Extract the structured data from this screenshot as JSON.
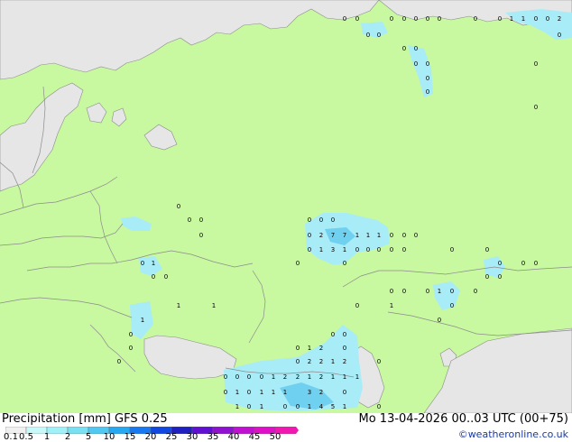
{
  "footer": {
    "title": "Precipitation [mm]  GFS 0.25",
    "datetime": "Mo 13-04-2026 00..03 UTC (00+75)",
    "credit": "©weatheronline.co.uk"
  },
  "legend": {
    "labels": [
      "0.1",
      "0.5",
      "1",
      "2",
      "5",
      "10",
      "15",
      "20",
      "25",
      "30",
      "35",
      "40",
      "45",
      "50"
    ],
    "colors": [
      "#f0f0f0",
      "#c8f8f8",
      "#a0f0f8",
      "#78e0f0",
      "#50c8f0",
      "#28a8f0",
      "#1878f0",
      "#1048e0",
      "#2020c0",
      "#6010d0",
      "#9010d0",
      "#c010d0",
      "#e010c8",
      "#f018b0"
    ]
  },
  "colors": {
    "land": "#c8f8a0",
    "sea": "#e6e6e6",
    "border": "#8c8c8c",
    "precip_light": "#a8ecf8",
    "precip_medium": "#70d0f0"
  },
  "precip_labels": [
    {
      "t": "0",
      "lon": 382,
      "lat": 20
    },
    {
      "t": "0",
      "lon": 396,
      "lat": 20
    },
    {
      "t": "0",
      "lon": 434,
      "lat": 20
    },
    {
      "t": "0",
      "lon": 448,
      "lat": 20
    },
    {
      "t": "0",
      "lon": 461,
      "lat": 20
    },
    {
      "t": "0",
      "lon": 474,
      "lat": 20
    },
    {
      "t": "0",
      "lon": 487,
      "lat": 20
    },
    {
      "t": "0",
      "lon": 527,
      "lat": 20
    },
    {
      "t": "0",
      "lon": 554,
      "lat": 20
    },
    {
      "t": "1",
      "lon": 567,
      "lat": 20
    },
    {
      "t": "1",
      "lon": 580,
      "lat": 20
    },
    {
      "t": "0",
      "lon": 594,
      "lat": 20
    },
    {
      "t": "0",
      "lon": 607,
      "lat": 20
    },
    {
      "t": "2",
      "lon": 620,
      "lat": 20
    },
    {
      "t": "0",
      "lon": 408,
      "lat": 38
    },
    {
      "t": "0",
      "lon": 420,
      "lat": 38
    },
    {
      "t": "0",
      "lon": 620,
      "lat": 38
    },
    {
      "t": "0",
      "lon": 448,
      "lat": 53
    },
    {
      "t": "0",
      "lon": 461,
      "lat": 53
    },
    {
      "t": "0",
      "lon": 461,
      "lat": 70
    },
    {
      "t": "0",
      "lon": 474,
      "lat": 70
    },
    {
      "t": "0",
      "lon": 594,
      "lat": 70
    },
    {
      "t": "0",
      "lon": 474,
      "lat": 86
    },
    {
      "t": "0",
      "lon": 474,
      "lat": 101
    },
    {
      "t": "0",
      "lon": 594,
      "lat": 118
    },
    {
      "t": "0",
      "lon": 198,
      "lat": 228
    },
    {
      "t": "0",
      "lon": 210,
      "lat": 243
    },
    {
      "t": "0",
      "lon": 223,
      "lat": 243
    },
    {
      "t": "0",
      "lon": 223,
      "lat": 260
    },
    {
      "t": "0",
      "lon": 343,
      "lat": 243
    },
    {
      "t": "0",
      "lon": 356,
      "lat": 243
    },
    {
      "t": "0",
      "lon": 369,
      "lat": 243
    },
    {
      "t": "0",
      "lon": 343,
      "lat": 260
    },
    {
      "t": "2",
      "lon": 356,
      "lat": 260
    },
    {
      "t": "7",
      "lon": 369,
      "lat": 260
    },
    {
      "t": "7",
      "lon": 382,
      "lat": 260
    },
    {
      "t": "1",
      "lon": 396,
      "lat": 260
    },
    {
      "t": "1",
      "lon": 408,
      "lat": 260
    },
    {
      "t": "1",
      "lon": 420,
      "lat": 260
    },
    {
      "t": "0",
      "lon": 434,
      "lat": 260
    },
    {
      "t": "0",
      "lon": 448,
      "lat": 260
    },
    {
      "t": "0",
      "lon": 461,
      "lat": 260
    },
    {
      "t": "0",
      "lon": 343,
      "lat": 276
    },
    {
      "t": "1",
      "lon": 356,
      "lat": 276
    },
    {
      "t": "3",
      "lon": 369,
      "lat": 276
    },
    {
      "t": "1",
      "lon": 382,
      "lat": 276
    },
    {
      "t": "0",
      "lon": 396,
      "lat": 276
    },
    {
      "t": "0",
      "lon": 408,
      "lat": 276
    },
    {
      "t": "0",
      "lon": 420,
      "lat": 276
    },
    {
      "t": "0",
      "lon": 434,
      "lat": 276
    },
    {
      "t": "0",
      "lon": 448,
      "lat": 276
    },
    {
      "t": "0",
      "lon": 501,
      "lat": 276
    },
    {
      "t": "0",
      "lon": 540,
      "lat": 276
    },
    {
      "t": "0",
      "lon": 382,
      "lat": 291
    },
    {
      "t": "0",
      "lon": 330,
      "lat": 291
    },
    {
      "t": "0",
      "lon": 554,
      "lat": 291
    },
    {
      "t": "0",
      "lon": 580,
      "lat": 291
    },
    {
      "t": "0",
      "lon": 594,
      "lat": 291
    },
    {
      "t": "0",
      "lon": 158,
      "lat": 291
    },
    {
      "t": "1",
      "lon": 170,
      "lat": 291
    },
    {
      "t": "0",
      "lon": 170,
      "lat": 306
    },
    {
      "t": "0",
      "lon": 184,
      "lat": 306
    },
    {
      "t": "0",
      "lon": 540,
      "lat": 306
    },
    {
      "t": "0",
      "lon": 554,
      "lat": 306
    },
    {
      "t": "0",
      "lon": 434,
      "lat": 322
    },
    {
      "t": "0",
      "lon": 448,
      "lat": 322
    },
    {
      "t": "0",
      "lon": 474,
      "lat": 322
    },
    {
      "t": "1",
      "lon": 487,
      "lat": 322
    },
    {
      "t": "0",
      "lon": 501,
      "lat": 322
    },
    {
      "t": "0",
      "lon": 527,
      "lat": 322
    },
    {
      "t": "0",
      "lon": 396,
      "lat": 338
    },
    {
      "t": "1",
      "lon": 434,
      "lat": 338
    },
    {
      "t": "0",
      "lon": 501,
      "lat": 338
    },
    {
      "t": "1",
      "lon": 198,
      "lat": 338
    },
    {
      "t": "1",
      "lon": 237,
      "lat": 338
    },
    {
      "t": "0",
      "lon": 487,
      "lat": 354
    },
    {
      "t": "1",
      "lon": 158,
      "lat": 354
    },
    {
      "t": "0",
      "lon": 145,
      "lat": 370
    },
    {
      "t": "0",
      "lon": 369,
      "lat": 370
    },
    {
      "t": "0",
      "lon": 382,
      "lat": 370
    },
    {
      "t": "0",
      "lon": 145,
      "lat": 385
    },
    {
      "t": "0",
      "lon": 330,
      "lat": 385
    },
    {
      "t": "1",
      "lon": 343,
      "lat": 385
    },
    {
      "t": "2",
      "lon": 356,
      "lat": 385
    },
    {
      "t": "0",
      "lon": 382,
      "lat": 385
    },
    {
      "t": "0",
      "lon": 132,
      "lat": 400
    },
    {
      "t": "0",
      "lon": 330,
      "lat": 400
    },
    {
      "t": "2",
      "lon": 343,
      "lat": 400
    },
    {
      "t": "2",
      "lon": 356,
      "lat": 400
    },
    {
      "t": "1",
      "lon": 369,
      "lat": 400
    },
    {
      "t": "2",
      "lon": 382,
      "lat": 400
    },
    {
      "t": "0",
      "lon": 420,
      "lat": 400
    },
    {
      "t": "0",
      "lon": 250,
      "lat": 417
    },
    {
      "t": "0",
      "lon": 263,
      "lat": 417
    },
    {
      "t": "0",
      "lon": 276,
      "lat": 417
    },
    {
      "t": "0",
      "lon": 290,
      "lat": 417
    },
    {
      "t": "1",
      "lon": 303,
      "lat": 417
    },
    {
      "t": "2",
      "lon": 316,
      "lat": 417
    },
    {
      "t": "2",
      "lon": 330,
      "lat": 417
    },
    {
      "t": "1",
      "lon": 343,
      "lat": 417
    },
    {
      "t": "2",
      "lon": 356,
      "lat": 417
    },
    {
      "t": "1",
      "lon": 369,
      "lat": 417
    },
    {
      "t": "1",
      "lon": 382,
      "lat": 417
    },
    {
      "t": "1",
      "lon": 396,
      "lat": 417
    },
    {
      "t": "0",
      "lon": 250,
      "lat": 434
    },
    {
      "t": "1",
      "lon": 263,
      "lat": 434
    },
    {
      "t": "0",
      "lon": 276,
      "lat": 434
    },
    {
      "t": "1",
      "lon": 290,
      "lat": 434
    },
    {
      "t": "1",
      "lon": 303,
      "lat": 434
    },
    {
      "t": "1",
      "lon": 316,
      "lat": 434
    },
    {
      "t": "3",
      "lon": 343,
      "lat": 434
    },
    {
      "t": "2",
      "lon": 356,
      "lat": 434
    },
    {
      "t": "0",
      "lon": 382,
      "lat": 434
    },
    {
      "t": "1",
      "lon": 263,
      "lat": 450
    },
    {
      "t": "0",
      "lon": 276,
      "lat": 450
    },
    {
      "t": "1",
      "lon": 290,
      "lat": 450
    },
    {
      "t": "0",
      "lon": 316,
      "lat": 450
    },
    {
      "t": "0",
      "lon": 330,
      "lat": 450
    },
    {
      "t": "1",
      "lon": 343,
      "lat": 450
    },
    {
      "t": "4",
      "lon": 356,
      "lat": 450
    },
    {
      "t": "5",
      "lon": 369,
      "lat": 450
    },
    {
      "t": "1",
      "lon": 382,
      "lat": 450
    },
    {
      "t": "0",
      "lon": 420,
      "lat": 450
    }
  ]
}
